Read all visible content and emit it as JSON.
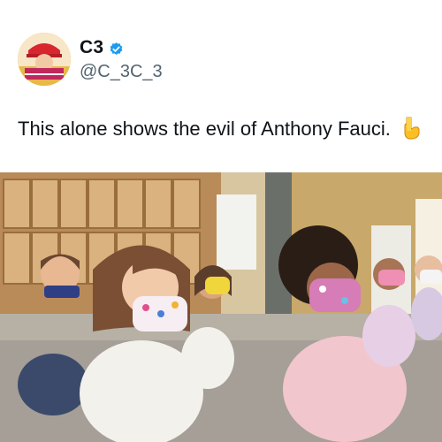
{
  "author": {
    "display_name": "C3",
    "handle": "@C_3C_3",
    "verified": true,
    "verified_color": "#1d9bf0"
  },
  "tweet": {
    "text": "This alone shows the evil of Anthony Fauci.",
    "emoji": "pointing-down-emoji"
  },
  "media": {
    "kind": "photo",
    "subject": "children sitting on classroom floor wearing face masks"
  },
  "colors": {
    "handle_gray": "#536471",
    "text": "#0f1419"
  }
}
